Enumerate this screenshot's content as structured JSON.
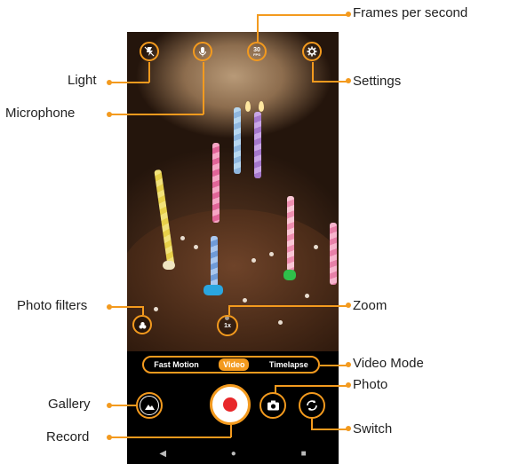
{
  "callouts": {
    "frames_per_second": "Frames per second",
    "light": "Light",
    "microphone": "Microphone",
    "settings": "Settings",
    "photo_filters": "Photo filters",
    "zoom": "Zoom",
    "video_mode": "Video Mode",
    "photo": "Photo",
    "gallery": "Gallery",
    "switch": "Switch",
    "record": "Record"
  },
  "top_bar": {
    "fps_value": "30",
    "fps_unit": "FPS"
  },
  "zoom_value": "1x",
  "modes": [
    "Fast Motion",
    "Video",
    "Timelapse"
  ],
  "active_mode": "Video",
  "icons": [
    "flash-off-icon",
    "microphone-icon",
    "settings-gear-icon",
    "filters-icon",
    "zoom-icon",
    "gallery-icon",
    "record-icon",
    "photo-camera-icon",
    "switch-camera-icon",
    "back-icon",
    "home-icon",
    "recents-icon"
  ],
  "colors": {
    "accent": "#f39a1e",
    "record": "#e8272a"
  }
}
